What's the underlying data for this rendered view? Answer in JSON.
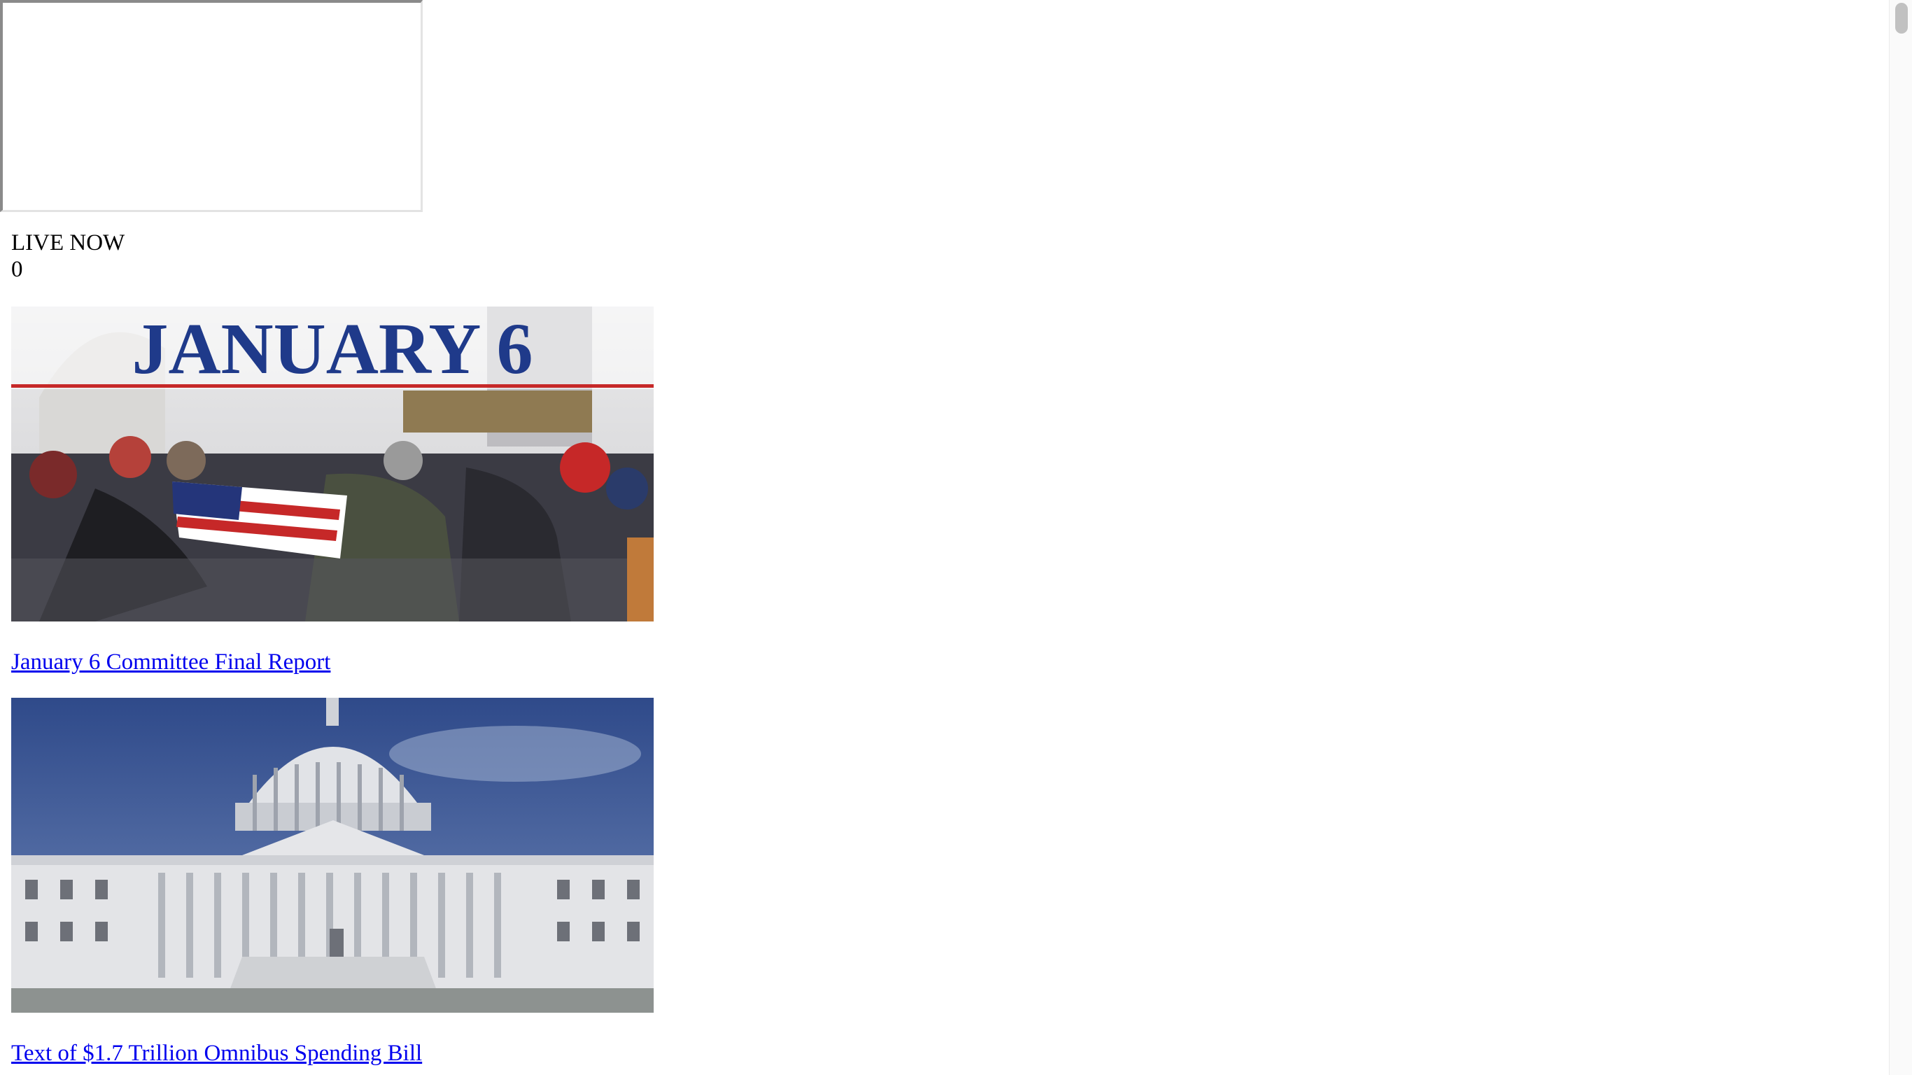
{
  "live": {
    "label": "LIVE NOW",
    "count": "0"
  },
  "stories": [
    {
      "image_caption": "JANUARY 6",
      "title": "January 6 Committee Final Report"
    },
    {
      "title": "Text of $1.7 Trillion Omnibus Spending Bill"
    }
  ],
  "colors": {
    "link": "#0000ee",
    "banner_text": "#1f3a8a",
    "banner_rule": "#c62828"
  }
}
